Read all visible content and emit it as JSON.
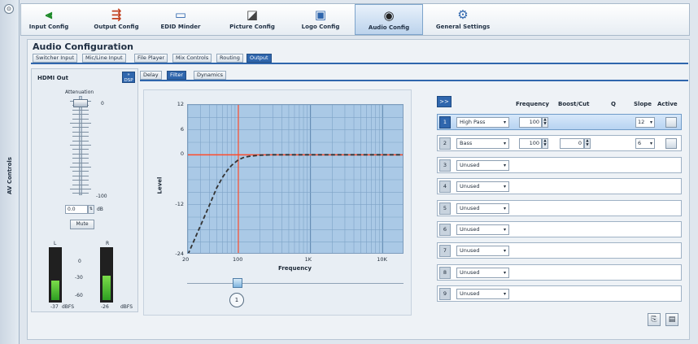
{
  "sidebar": {
    "toggle": "⊙",
    "label": "AV Controls"
  },
  "toolbar": {
    "items": [
      {
        "label": "Input Config",
        "icon": "input-icon"
      },
      {
        "label": "Output Config",
        "icon": "output-icon"
      },
      {
        "label": "EDID Minder",
        "icon": "monitor-icon"
      },
      {
        "label": "Picture Config",
        "icon": "picture-icon"
      },
      {
        "label": "Logo Config",
        "icon": "logo-icon"
      },
      {
        "label": "Audio Config",
        "icon": "speaker-icon",
        "active": true
      },
      {
        "label": "General Settings",
        "icon": "gears-icon"
      }
    ]
  },
  "page": {
    "title": "Audio Configuration",
    "tabs": [
      "Switcher Input",
      "Mic/Line Input",
      "File Player",
      "Mix Controls",
      "Routing",
      "Output"
    ],
    "active_tab": "Output"
  },
  "output_panel": {
    "title": "HDMI Out",
    "dsp_button": "»\nDSP",
    "attenuation_label": "Attenuation",
    "scale_top": "0",
    "scale_bottom": "-100",
    "attenuation_value": "0.0",
    "attenuation_unit": "dB",
    "mute_label": "Mute",
    "meter_left_label": "L",
    "meter_right_label": "R",
    "meter_scale": [
      "0",
      "-30",
      "-60"
    ],
    "meter_left_value": "-37",
    "meter_right_value": "-26",
    "meter_unit": "dBFS"
  },
  "processing_tabs": {
    "items": [
      "Delay",
      "Filter",
      "Dynamics"
    ],
    "active": "Filter"
  },
  "chart_data": {
    "type": "line",
    "xlabel": "Frequency",
    "ylabel": "Level",
    "x_ticks": [
      "20",
      "100",
      "1K",
      "10K"
    ],
    "y_ticks": [
      "12",
      "6",
      "0",
      "-12",
      "-24"
    ],
    "xlim": [
      20,
      20000
    ],
    "ylim": [
      -24,
      12
    ],
    "x_scale": "log",
    "grid": true,
    "marker_frequency": 100,
    "series": [
      {
        "color": "#333333",
        "style": "dashed",
        "x": [
          20,
          30,
          40,
          50,
          60,
          70,
          80,
          100,
          120,
          150,
          200,
          300,
          500,
          1000,
          5000,
          20000
        ],
        "y": [
          -24,
          -17,
          -12,
          -8,
          -5.5,
          -3.8,
          -2.6,
          -1.2,
          -0.6,
          -0.3,
          -0.1,
          0,
          0,
          0,
          0,
          0
        ]
      }
    ],
    "zero_line_color": "#ff4a2a"
  },
  "band_selector": {
    "label": "1",
    "circle": "1"
  },
  "filter_table": {
    "expand_label": ">>",
    "headers": {
      "frequency": "Frequency",
      "boost": "Boost/Cut",
      "q": "Q",
      "slope": "Slope",
      "active": "Active"
    },
    "rows": [
      {
        "num": "1",
        "type": "High Pass",
        "freq": "100",
        "boost": "",
        "slope": "12",
        "selected": true
      },
      {
        "num": "2",
        "type": "Bass",
        "freq": "100",
        "boost": "0",
        "slope": "6"
      },
      {
        "num": "3",
        "type": "Unused"
      },
      {
        "num": "4",
        "type": "Unused"
      },
      {
        "num": "5",
        "type": "Unused"
      },
      {
        "num": "6",
        "type": "Unused"
      },
      {
        "num": "7",
        "type": "Unused"
      },
      {
        "num": "8",
        "type": "Unused"
      },
      {
        "num": "9",
        "type": "Unused"
      }
    ]
  },
  "actions": {
    "copy_icon": "copy-icon",
    "paste_icon": "paste-icon"
  },
  "colors": {
    "accent": "#2f66ad",
    "graph_bg": "#aac9e6",
    "meter_green": "#3fb42a"
  }
}
